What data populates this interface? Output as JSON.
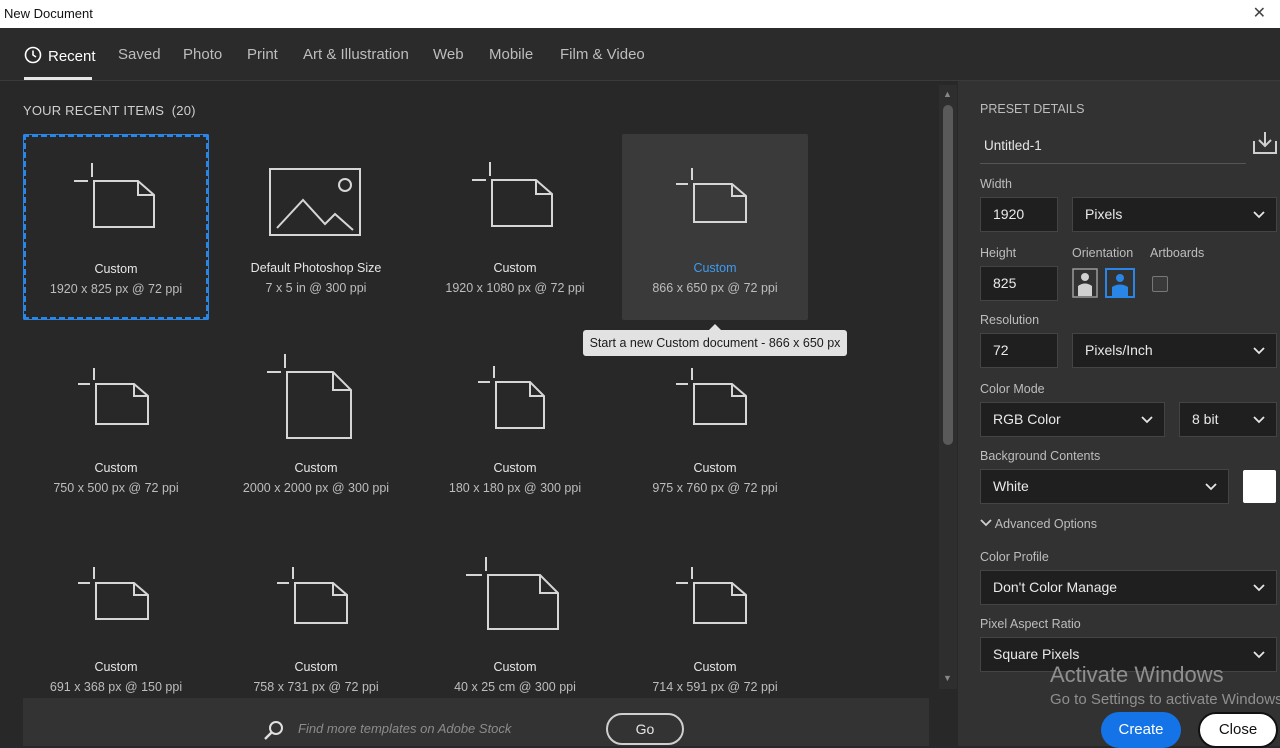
{
  "window": {
    "title": "New Document",
    "close_glyph": "✕"
  },
  "tabs": [
    {
      "label": "Recent",
      "icon": "clock-icon"
    },
    {
      "label": "Saved"
    },
    {
      "label": "Photo"
    },
    {
      "label": "Print"
    },
    {
      "label": "Art & Illustration"
    },
    {
      "label": "Web"
    },
    {
      "label": "Mobile"
    },
    {
      "label": "Film & Video"
    }
  ],
  "recent": {
    "title": "YOUR RECENT ITEMS",
    "count": "(20)",
    "items": [
      {
        "name": "Custom",
        "dims": "1920 x 825 px @ 72 ppi"
      },
      {
        "name": "Default Photoshop Size",
        "dims": "7 x 5 in @ 300 ppi"
      },
      {
        "name": "Custom",
        "dims": "1920 x 1080 px @ 72 ppi"
      },
      {
        "name": "Custom",
        "dims": "866 x 650 px @ 72 ppi"
      },
      {
        "name": "Custom",
        "dims": "750 x 500 px @ 72 ppi"
      },
      {
        "name": "Custom",
        "dims": "2000 x 2000 px @ 300 ppi"
      },
      {
        "name": "Custom",
        "dims": "180 x 180 px @ 300 ppi"
      },
      {
        "name": "Custom",
        "dims": "975 x 760 px @ 72 ppi"
      },
      {
        "name": "Custom",
        "dims": "691 x 368 px @ 150 ppi"
      },
      {
        "name": "Custom",
        "dims": "758 x 731 px @ 72 ppi"
      },
      {
        "name": "Custom",
        "dims": "40 x 25 cm @ 300 ppi"
      },
      {
        "name": "Custom",
        "dims": "714 x 591 px @ 72 ppi"
      }
    ],
    "tooltip": "Start a new Custom document - 866 x 650 px"
  },
  "footer": {
    "search_placeholder": "Find more templates on Adobe Stock",
    "go_label": "Go"
  },
  "preset": {
    "title": "PRESET DETAILS",
    "name": "Untitled-1",
    "width_label": "Width",
    "width": "1920",
    "width_unit": "Pixels",
    "height_label": "Height",
    "height": "825",
    "orientation_label": "Orientation",
    "artboards_label": "Artboards",
    "resolution_label": "Resolution",
    "resolution": "72",
    "resolution_unit": "Pixels/Inch",
    "color_mode_label": "Color Mode",
    "color_mode": "RGB Color",
    "bit_depth": "8 bit",
    "background_label": "Background Contents",
    "background": "White",
    "advanced_label": "Advanced Options",
    "color_profile_label": "Color Profile",
    "color_profile": "Don't Color Manage",
    "pixel_aspect_label": "Pixel Aspect Ratio",
    "pixel_aspect": "Square Pixels"
  },
  "watermark": {
    "line1": "Activate Windows",
    "line2": "Go to Settings to activate Windows."
  },
  "actions": {
    "create": "Create",
    "close": "Close"
  },
  "colors": {
    "accent": "#1473e6",
    "selection": "#2a86e6",
    "hover_text": "#3f9cf0"
  }
}
